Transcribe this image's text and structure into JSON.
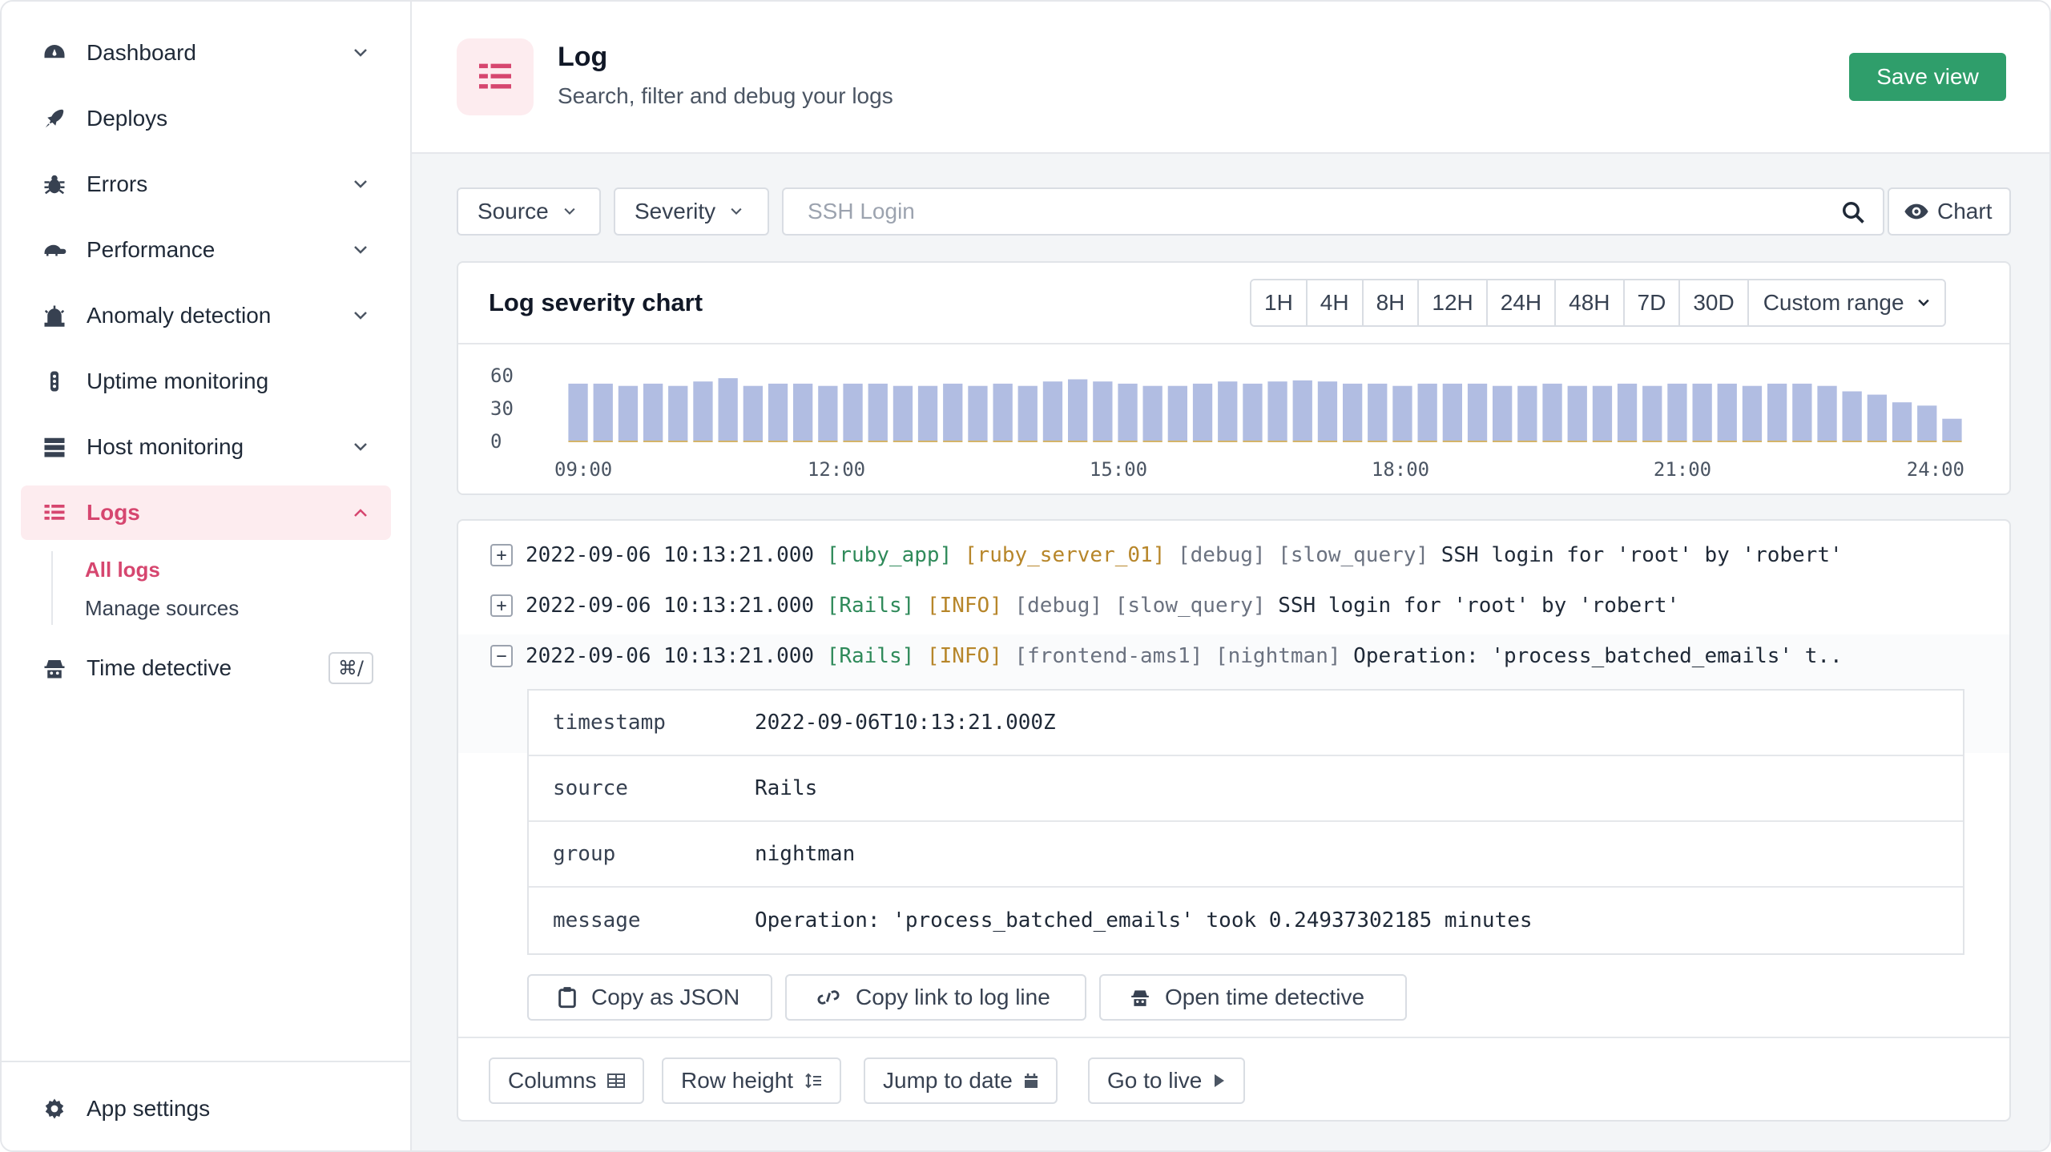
{
  "sidebar": {
    "items": [
      {
        "label": "Dashboard",
        "icon": "gauge-icon",
        "has_chevron": true
      },
      {
        "label": "Deploys",
        "icon": "rocket-icon",
        "has_chevron": false
      },
      {
        "label": "Errors",
        "icon": "bug-icon",
        "has_chevron": true
      },
      {
        "label": "Performance",
        "icon": "turtle-icon",
        "has_chevron": true
      },
      {
        "label": "Anomaly detection",
        "icon": "alarm-icon",
        "has_chevron": true
      },
      {
        "label": "Uptime monitoring",
        "icon": "traffic-light-icon",
        "has_chevron": false
      },
      {
        "label": "Host monitoring",
        "icon": "server-icon",
        "has_chevron": true
      },
      {
        "label": "Logs",
        "icon": "logs-icon",
        "has_chevron": true,
        "active": true
      },
      {
        "label": "Time detective",
        "icon": "detective-icon",
        "shortcut": "⌘/"
      }
    ],
    "logs_sub": [
      {
        "label": "All logs",
        "active": true
      },
      {
        "label": "Manage sources",
        "active": false
      }
    ],
    "settings_label": "App settings"
  },
  "header": {
    "title": "Log",
    "subtitle": "Search, filter and debug your logs",
    "save_label": "Save view"
  },
  "filters": {
    "source_label": "Source",
    "severity_label": "Severity",
    "search_placeholder": "SSH Login",
    "chart_toggle_label": "Chart"
  },
  "chart_card": {
    "title": "Log severity chart",
    "ranges": [
      "1H",
      "4H",
      "8H",
      "12H",
      "24H",
      "48H",
      "7D",
      "30D"
    ],
    "custom_range_label": "Custom range"
  },
  "chart_data": {
    "type": "bar",
    "title": "Log severity chart",
    "x_ticks": [
      "09:00",
      "12:00",
      "15:00",
      "18:00",
      "21:00",
      "24:00"
    ],
    "y_ticks": [
      "60",
      "30",
      "0"
    ],
    "ylim": [
      0,
      60
    ],
    "values": [
      52,
      52,
      50,
      52,
      50,
      54,
      57,
      50,
      52,
      52,
      50,
      52,
      52,
      50,
      50,
      52,
      50,
      52,
      50,
      54,
      56,
      54,
      52,
      50,
      50,
      52,
      54,
      52,
      54,
      55,
      54,
      52,
      52,
      50,
      52,
      52,
      52,
      50,
      50,
      52,
      50,
      50,
      52,
      50,
      52,
      52,
      52,
      50,
      52,
      52,
      50,
      45,
      42,
      35,
      32,
      20
    ],
    "color": "#b1bde2",
    "accent_color": "#d4b46a"
  },
  "logs": [
    {
      "expanded": false,
      "timestamp": "2022-09-06 10:13:21.000",
      "tag1": "[ruby_app]",
      "tag1_color": "green",
      "tag2": "[ruby_server_01]",
      "tag2_color": "yellow",
      "tag3": "[debug]",
      "tag4": "[slow_query]",
      "message": "SSH login for 'root' by 'robert'"
    },
    {
      "expanded": false,
      "timestamp": "2022-09-06 10:13:21.000",
      "tag1": "[Rails]",
      "tag1_color": "green",
      "tag2": "[INFO]",
      "tag2_color": "yellow",
      "tag3": "[debug]",
      "tag4": "[slow_query]",
      "message": "SSH login for 'root' by 'robert'"
    },
    {
      "expanded": true,
      "timestamp": "2022-09-06 10:13:21.000",
      "tag1": "[Rails]",
      "tag1_color": "green",
      "tag2": "[INFO]",
      "tag2_color": "yellow",
      "tag3": "[frontend-ams1]",
      "tag4": "[nightman]",
      "message": "Operation: 'process_batched_emails' t.."
    }
  ],
  "detail": [
    {
      "key": "timestamp",
      "value": "2022-09-06T10:13:21.000Z"
    },
    {
      "key": "source",
      "value": "Rails"
    },
    {
      "key": "group",
      "value": "nightman"
    },
    {
      "key": "message",
      "value": "Operation: 'process_batched_emails' took 0.24937302185 minutes"
    }
  ],
  "actions": {
    "copy_json": "Copy as JSON",
    "copy_link": "Copy link to log line",
    "open_detective": "Open time detective"
  },
  "footer": {
    "columns": "Columns",
    "row_height": "Row height",
    "jump_to_date": "Jump to date",
    "go_to_live": "Go to live"
  },
  "colors": {
    "accent": "#d6466f",
    "save": "#2f9e6b",
    "bar": "#b1bde2"
  }
}
